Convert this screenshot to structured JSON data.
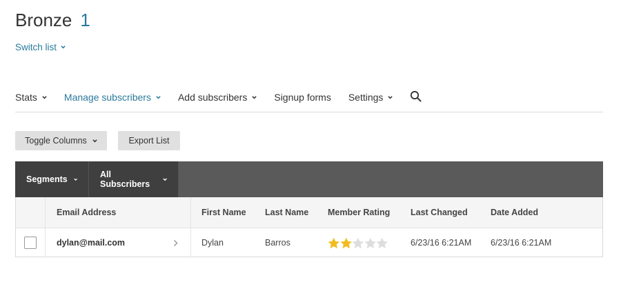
{
  "header": {
    "list_name": "Bronze",
    "list_count": "1",
    "switch_label": "Switch list"
  },
  "nav": {
    "items": [
      {
        "label": "Stats",
        "dropdown": true,
        "active": false
      },
      {
        "label": "Manage subscribers",
        "dropdown": true,
        "active": true
      },
      {
        "label": "Add subscribers",
        "dropdown": true,
        "active": false
      },
      {
        "label": "Signup forms",
        "dropdown": false,
        "active": false
      },
      {
        "label": "Settings",
        "dropdown": true,
        "active": false
      }
    ],
    "search_icon": "search-icon"
  },
  "toolbar": {
    "toggle_columns_label": "Toggle Columns",
    "export_list_label": "Export List"
  },
  "segments": {
    "segments_label": "Segments",
    "all_subscribers_label": "All Subscribers"
  },
  "table": {
    "columns": [
      "Email Address",
      "First Name",
      "Last Name",
      "Member Rating",
      "Last Changed",
      "Date Added"
    ],
    "rows": [
      {
        "email": "dylan@mail.com",
        "first_name": "Dylan",
        "last_name": "Barros",
        "rating": 2,
        "rating_max": 5,
        "last_changed": "6/23/16 6:21AM",
        "date_added": "6/23/16 6:21AM"
      }
    ]
  },
  "colors": {
    "accent": "#2a7a9b",
    "star_filled": "#f0bd1e",
    "star_empty": "#dddddd",
    "segment_bar": "#5a5a5a",
    "segment_button": "#3f3f3f"
  }
}
